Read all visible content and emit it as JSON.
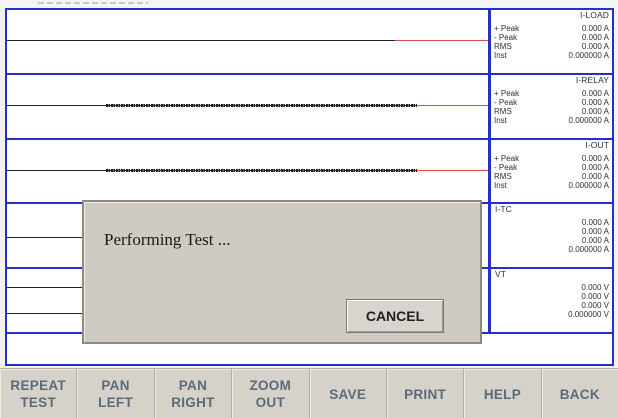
{
  "channels": [
    {
      "title": "I-LOAD",
      "unit": "A",
      "readings": {
        "plus_peak": "0.000 A",
        "minus_peak": "0.000 A",
        "rms": "0.000 A",
        "inst": "0.000000 A"
      }
    },
    {
      "title": "I-RELAY",
      "unit": "A",
      "readings": {
        "plus_peak": "0.000 A",
        "minus_peak": "0.000 A",
        "rms": "0.000 A",
        "inst": "0.000000 A"
      }
    },
    {
      "title": "I-OUT",
      "unit": "A",
      "readings": {
        "plus_peak": "0.000 A",
        "minus_peak": "0.000 A",
        "rms": "0.000 A",
        "inst": "0.000000 A"
      }
    },
    {
      "title": "I-TC",
      "unit": "A",
      "readings": {
        "plus_peak": "0.000 A",
        "minus_peak": "0.000 A",
        "rms": "0.000 A",
        "inst": "0.000000 A"
      }
    },
    {
      "title": "VT",
      "unit": "V",
      "readings": {
        "plus_peak": "0.000 V",
        "minus_peak": "0.000 V",
        "rms": "0.000 V",
        "inst": "0.000000 V"
      }
    }
  ],
  "readout_labels": {
    "plus_peak": "+ Peak",
    "minus_peak": "- Peak",
    "rms": "RMS",
    "inst": "Inst"
  },
  "dialog": {
    "message": "Performing Test ...",
    "cancel_label": "CANCEL"
  },
  "toolbar": [
    {
      "id": "repeat-test",
      "line1": "REPEAT",
      "line2": "TEST"
    },
    {
      "id": "pan-left",
      "line1": "PAN",
      "line2": "LEFT"
    },
    {
      "id": "pan-right",
      "line1": "PAN",
      "line2": "RIGHT"
    },
    {
      "id": "zoom-out",
      "line1": "ZOOM",
      "line2": "OUT"
    },
    {
      "id": "save",
      "line1": "SAVE",
      "line2": ""
    },
    {
      "id": "print",
      "line1": "PRINT",
      "line2": ""
    },
    {
      "id": "help",
      "line1": "HELP",
      "line2": ""
    },
    {
      "id": "back",
      "line1": "BACK",
      "line2": ""
    }
  ],
  "colors": {
    "frame_border": "#2430c8",
    "trace": "#202020",
    "trace_tail": "#e04848",
    "dialog_bg": "#cfcbc3",
    "button_text": "#5b6a7a"
  }
}
